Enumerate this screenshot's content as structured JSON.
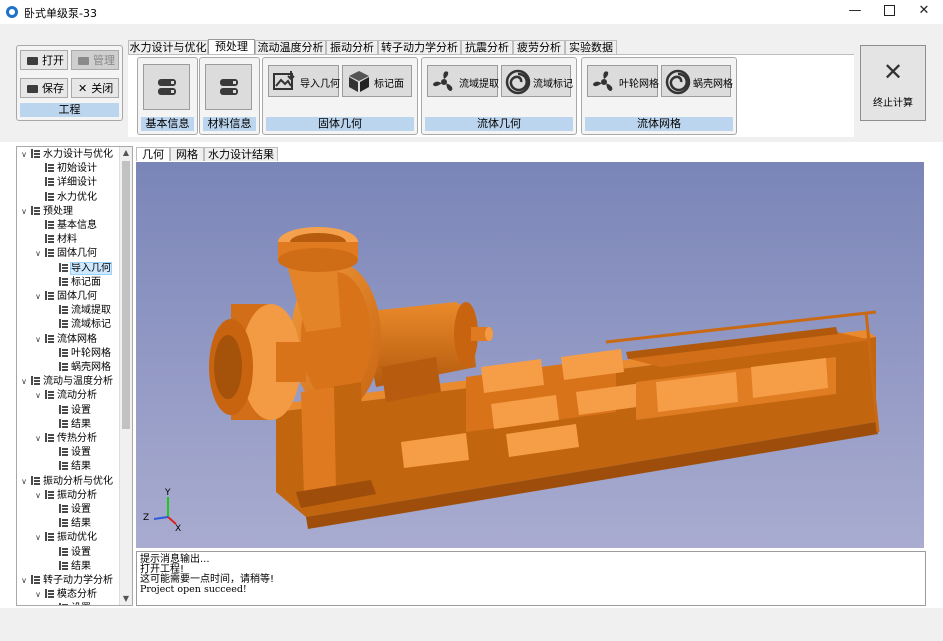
{
  "window": {
    "title": "卧式单级泵-33",
    "min": "—",
    "close": "✕"
  },
  "project_group": {
    "open": "打开",
    "manage": "管理",
    "save": "保存",
    "close": "关闭",
    "label": "工程"
  },
  "tabs": [
    "水力设计与优化",
    "预处理",
    "流动温度分析",
    "振动分析",
    "转子动力学分析",
    "抗震分析",
    "疲劳分析",
    "实验数据"
  ],
  "ribbon": {
    "basic_info": "基本信息",
    "material_info": "材料信息",
    "solid_geometry": {
      "label": "固体几何",
      "import": "导入几何",
      "mark": "标记面"
    },
    "fluid_geometry": {
      "label": "流体几何",
      "extract": "流域提取",
      "mark": "流域标记"
    },
    "fluid_mesh": {
      "label": "流体网格",
      "impeller": "叶轮网格",
      "volute": "蜗壳网格"
    }
  },
  "stop_button": {
    "icon": "✕",
    "label": "终止计算"
  },
  "tree": [
    {
      "label": "水力设计与优化",
      "level": 0,
      "expanded": true
    },
    {
      "label": "初始设计",
      "level": 1
    },
    {
      "label": "详细设计",
      "level": 1
    },
    {
      "label": "水力优化",
      "level": 1
    },
    {
      "label": "预处理",
      "level": 0,
      "expanded": true
    },
    {
      "label": "基本信息",
      "level": 1
    },
    {
      "label": "材料",
      "level": 1
    },
    {
      "label": "固体几何",
      "level": 1,
      "expanded": true
    },
    {
      "label": "导入几何",
      "level": 2,
      "selected": true
    },
    {
      "label": "标记面",
      "level": 2
    },
    {
      "label": "固体几何",
      "level": 1,
      "expanded": true
    },
    {
      "label": "流域提取",
      "level": 2
    },
    {
      "label": "流域标记",
      "level": 2
    },
    {
      "label": "流体网格",
      "level": 1,
      "expanded": true
    },
    {
      "label": "叶轮网格",
      "level": 2
    },
    {
      "label": "蜗壳网格",
      "level": 2
    },
    {
      "label": "流动与温度分析",
      "level": 0,
      "expanded": true
    },
    {
      "label": "流动分析",
      "level": 1,
      "expanded": true
    },
    {
      "label": "设置",
      "level": 2
    },
    {
      "label": "结果",
      "level": 2
    },
    {
      "label": "传热分析",
      "level": 1,
      "expanded": true
    },
    {
      "label": "设置",
      "level": 2
    },
    {
      "label": "结果",
      "level": 2
    },
    {
      "label": "振动分析与优化",
      "level": 0,
      "expanded": true
    },
    {
      "label": "振动分析",
      "level": 1,
      "expanded": true
    },
    {
      "label": "设置",
      "level": 2
    },
    {
      "label": "结果",
      "level": 2
    },
    {
      "label": "振动优化",
      "level": 1,
      "expanded": true
    },
    {
      "label": "设置",
      "level": 2
    },
    {
      "label": "结果",
      "level": 2
    },
    {
      "label": "转子动力学分析",
      "level": 0,
      "expanded": true
    },
    {
      "label": "模态分析",
      "level": 1,
      "expanded": true
    },
    {
      "label": "设置",
      "level": 2
    }
  ],
  "view_tabs": [
    "几何",
    "网格",
    "水力设计结果"
  ],
  "axes": {
    "x": "X",
    "y": "Y",
    "z": "Z"
  },
  "colors": {
    "model": "#e0781e",
    "viewport_top": "#7a85b8",
    "viewport_bottom": "#a9acd0",
    "group_label": "#bcd5ee"
  },
  "console": [
    "提示消息输出...",
    "打开工程!",
    "这可能需要一点时间，请稍等!",
    "Project open succeed!"
  ]
}
